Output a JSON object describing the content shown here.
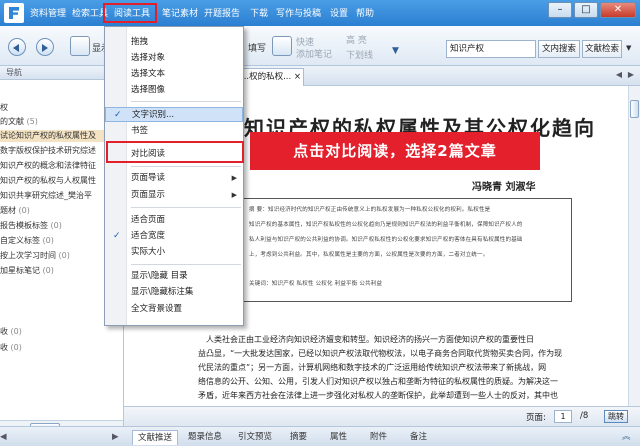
{
  "colors": {
    "accent": "#2b7fd1",
    "highlight": "#e2202c",
    "selection": "#f4e3c3"
  },
  "menubar": {
    "items": [
      "资料管理",
      "检索工具",
      "阅读工具",
      "笔记素材",
      "开题报告",
      "下载",
      "写作与投稿",
      "设置",
      "帮助"
    ]
  },
  "toolbar": {
    "show_label": "显示",
    "fill_label": "填写",
    "quick_label": "快速",
    "add_note_label": "添加笔记",
    "highlight_label": "高 亮",
    "underline_label": "下划线",
    "search_value": "知识产权",
    "search_inner_btn": "文内搜索",
    "search_lit_btn": "文献检索"
  },
  "left_panel": {
    "header": "导航",
    "items": [
      {
        "text": "权",
        "count": ""
      },
      {
        "text": "的文献",
        "count": "(5)"
      },
      {
        "text": "试论知识产权的私权属性及",
        "count": ""
      },
      {
        "text": "数字版权保护技术研究综述",
        "count": ""
      },
      {
        "text": "知识产权的概念和法律特征",
        "count": ""
      },
      {
        "text": "知识产权的私权与人权属性",
        "count": ""
      },
      {
        "text": "知识共享研究综述_樊治平",
        "count": ""
      },
      {
        "text": "题材",
        "count": "(0)"
      },
      {
        "text": "报告模板标签",
        "count": "(0)"
      },
      {
        "text": "自定义标签",
        "count": "(0)"
      },
      {
        "text": "按上次学习时间",
        "count": "(0)"
      },
      {
        "text": "加星标笔记",
        "count": "(0)"
      },
      {
        "text": "收",
        "count": "(0)"
      },
      {
        "text": "收",
        "count": "(0)"
      }
    ]
  },
  "doc": {
    "tab_label": "...权的私权... ×",
    "title": "知识产权的私权属性及其公权化趋向",
    "authors": "冯晓青  刘淑华",
    "abstract_lines": [
      "摘 要：知识经济时代的知识产权正由传统意义上的私权发展为一种私权公权化的权利。私权性是",
      "知识产权的基本属性，知识产权私权性的公权化趋向乃是规则知识产权法的利益平衡机制，保障知识产权人的",
      "私人利益与知识产权的公共利益的协调。知识产权私权性的公权化要求知识产权的客体在具有私权属性的基础",
      "上，考虑到公共利益。其中，私权属性是主要的方面，公权属性是次要的方面，二者对立统一。",
      "关键词：知识产权  私权性  公权化  利益平衡  公共利益"
    ],
    "body_lines": [
      "人类社会正由工业经济向知识经济嬗变和转型。知识经济的扬兴一方面使知识产权的重要性日",
      "益凸显，“一大批发达国家，已经以知识产权法取代物权法，以电子商务合同取代货物买卖合同，作为现",
      "代民法的重点”；另一方面，计算机网络和数字技术的广泛运用给传统知识产权法带来了新挑战，网",
      "络信息的公开、公知、公用，引发人们对知识产权以独占和垄断为特征的私权属性的质疑。为解决这一",
      "矛盾，近年来西方社会在法律上进一步强化对私权人的垄断保护，此举却遭到一些人士的反对，其中也"
    ]
  },
  "annotation": {
    "banner_text": "点击对比阅读，选择2篇文章"
  },
  "statusbar": {
    "page_label": "页面:",
    "page_value": "1",
    "page_total": "/8",
    "jump_label": "跳转"
  },
  "bottom_tabs": [
    "文献推送",
    "题录信息",
    "引文预览",
    "摘要",
    "属性",
    "附件",
    "备注"
  ],
  "dropdown": {
    "items": [
      {
        "label": "拖拽",
        "checked": false,
        "submenu": false
      },
      {
        "label": "选择对象",
        "checked": false,
        "submenu": false
      },
      {
        "label": "选择文本",
        "checked": false,
        "submenu": false
      },
      {
        "label": "选择图像",
        "checked": false,
        "submenu": false
      },
      {
        "label": "文字识别...",
        "checked": true,
        "submenu": false
      },
      {
        "label": "书签",
        "checked": false,
        "submenu": false
      },
      {
        "label": "对比阅读",
        "checked": false,
        "submenu": false
      },
      {
        "label": "页面导读",
        "checked": false,
        "submenu": true
      },
      {
        "label": "页面显示",
        "checked": false,
        "submenu": true
      },
      {
        "label": "适合页面",
        "checked": false,
        "submenu": false
      },
      {
        "label": "适合宽度",
        "checked": true,
        "submenu": false
      },
      {
        "label": "实际大小",
        "checked": false,
        "submenu": false
      },
      {
        "label": "显示\\隐藏 目录",
        "checked": false,
        "submenu": false
      },
      {
        "label": "显示\\隐藏标注集",
        "checked": false,
        "submenu": false
      },
      {
        "label": "全文背景设置",
        "checked": false,
        "submenu": false
      }
    ]
  }
}
